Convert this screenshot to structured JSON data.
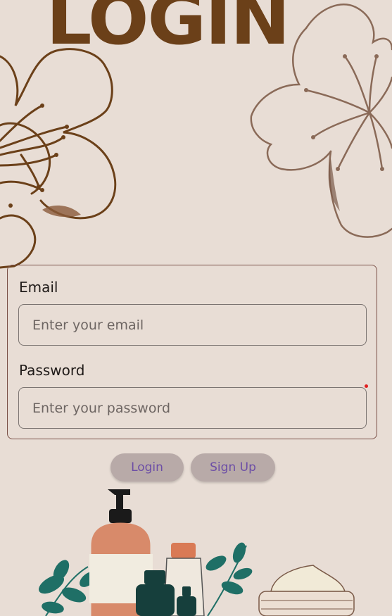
{
  "header": {
    "title": "LOGIN"
  },
  "form": {
    "email_label": "Email",
    "email_placeholder": "Enter your email",
    "email_value": "",
    "password_label": "Password",
    "password_placeholder": "Enter your password",
    "password_value": ""
  },
  "actions": {
    "login_label": "Login",
    "signup_label": "Sign Up"
  },
  "colors": {
    "background": "#e8ddd5",
    "title": "#6b4019",
    "button_bg": "#b8aaa8",
    "button_text": "#6c4ea6",
    "flower_left": "#6b4019",
    "flower_right": "#8a6a58",
    "leaf": "#1f6f66"
  },
  "icons": [
    "flower-left-illustration",
    "flower-right-illustration",
    "cosmetics-illustration"
  ]
}
